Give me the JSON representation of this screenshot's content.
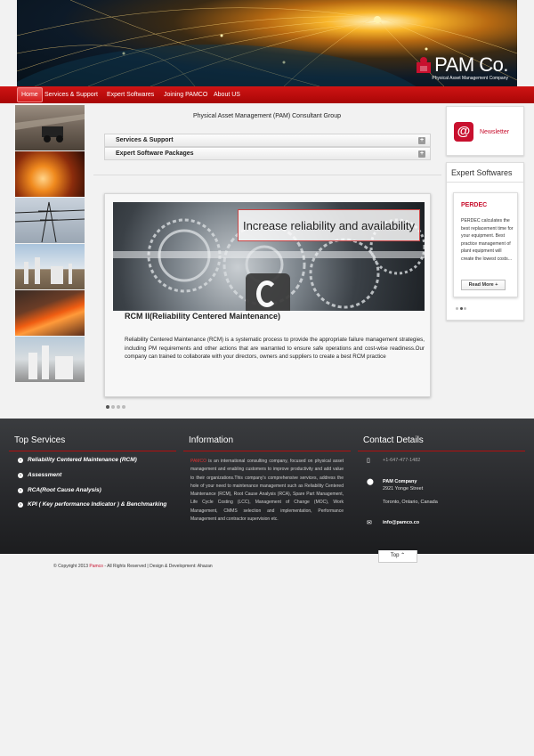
{
  "brand": {
    "logo_text": "PAM Co.",
    "logo_subtitle": "Physical Asset Management Company",
    "accent": "#c8102e"
  },
  "nav": {
    "items": [
      {
        "label": "Home",
        "active": true
      },
      {
        "label": "Services & Support"
      },
      {
        "label": "Expert Softwares"
      },
      {
        "label": "Joining PAMCO"
      },
      {
        "label": "About US"
      }
    ]
  },
  "main": {
    "intro_title": "Physical Asset Management (PAM) Consultant Group",
    "accordion": [
      {
        "label": "Services & Support",
        "icon": "plus-icon"
      },
      {
        "label": "Expert Software Packages",
        "icon": "plus-icon"
      }
    ],
    "slide": {
      "banner": "Increase reliability and availability",
      "title": "RCM II(Reliability Centered Maintenance)",
      "text": "Reliability Centered Maintenance (RCM) is a systematic process to provide the appropriate failure management strategies, including PM requirements and other actions that are warranted to ensure safe operations and cost-wise readiness.Our company can trained to collaborate with your directors, owners and suppliers to create a best RCM practice"
    }
  },
  "sidebar": {
    "newsletter_label": "Newsletter",
    "newsletter_icon": "at-sign-icon",
    "expert_title": "Expert Softwares",
    "card": {
      "title": "PERDEC",
      "text": "PERDEC calculates the best replacement time for your equipment. Best practice management of plant equipment will create the lowest costs...",
      "button": "Read More +"
    }
  },
  "footer": {
    "services_title": "Top Services",
    "services": [
      "Reliability Centered Maintenance (RCM)",
      "Assessment",
      "RCA(Root Cause Analysis)",
      "KPI ( Key performance Indicator ) & Benchmarking"
    ],
    "info_title": "Information",
    "info_brand": "PAMCO",
    "info_text": " is an international consulting company, focused on physical asset management and enabling customers to improve productivity and add value to their organizations.This company's comprehensive services, address the hole of your need to maintenance management such as Reliability Centered Maintenance (RCM), Root Cause Analysis (RCA), Spare Part Management, Life Cycle Costing (LCC), Management of Change (MOC), Work Management, CMMS selection and implementation, Performance Management and contractor supervision etc.",
    "contact_title": "Contact Details",
    "phone": "+1-647-477-1482",
    "company": "PAM Company",
    "street": "2921 Yonge Street",
    "city": "Toronto, Ontario, Canada",
    "email": "info@pamco.co"
  },
  "bottom": {
    "copyright_pre": "© Copyright 2013 ",
    "copyright_brand": "Pamco",
    "copyright_post": " - All Rights Reserved | Design & Development: Ahazan",
    "top_label": "Top"
  }
}
